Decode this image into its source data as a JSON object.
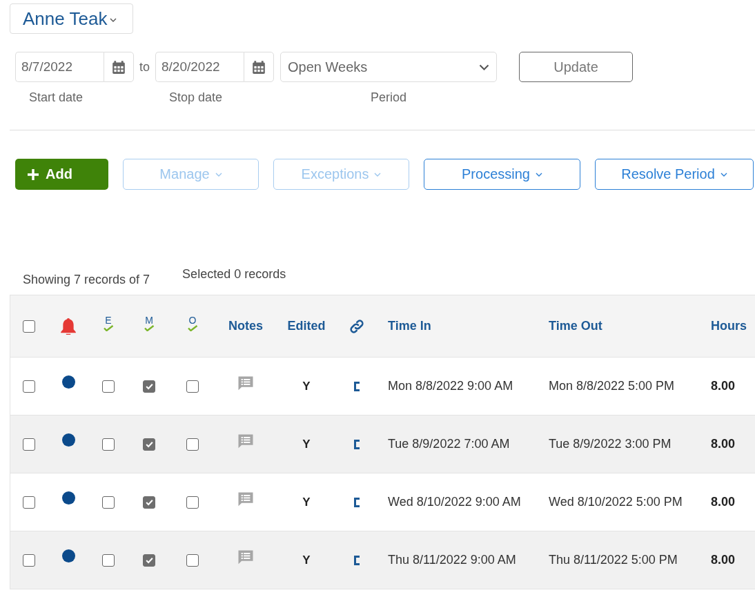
{
  "employee": {
    "name": "Anne Teak"
  },
  "filters": {
    "start_date": {
      "value": "8/7/2022",
      "label": "Start date"
    },
    "separator": "to",
    "stop_date": {
      "value": "8/20/2022",
      "label": "Stop date"
    },
    "period": {
      "value": "Open Weeks",
      "label": "Period"
    },
    "update_button": "Update"
  },
  "actions": [
    {
      "label": "Add",
      "kind": "primary",
      "disabled": false
    },
    {
      "label": "Manage",
      "kind": "menu",
      "disabled": true
    },
    {
      "label": "Exceptions",
      "kind": "menu",
      "disabled": true
    },
    {
      "label": "Processing",
      "kind": "menu",
      "disabled": false
    },
    {
      "label": "Resolve Period",
      "kind": "menu",
      "disabled": false
    }
  ],
  "summary": {
    "showing": "Showing 7 records of 7",
    "selected": "Selected 0 records"
  },
  "table": {
    "header": {
      "select_all_checked": false,
      "e": "E",
      "m": "M",
      "o": "O",
      "notes": "Notes",
      "edited": "Edited",
      "time_in": "Time In",
      "time_out": "Time Out",
      "hours": "Hours"
    },
    "rows": [
      {
        "selected": false,
        "color": "#0b4a8b",
        "e": false,
        "m": true,
        "o": false,
        "edited": "Y",
        "time_in": "Mon 8/8/2022 9:00 AM",
        "time_out": "Mon 8/8/2022 5:00 PM",
        "hours": "8.00"
      },
      {
        "selected": false,
        "color": "#0b4a8b",
        "e": false,
        "m": true,
        "o": false,
        "edited": "Y",
        "time_in": "Tue 8/9/2022 7:00 AM",
        "time_out": "Tue 8/9/2022 3:00 PM",
        "hours": "8.00"
      },
      {
        "selected": false,
        "color": "#0b4a8b",
        "e": false,
        "m": true,
        "o": false,
        "edited": "Y",
        "time_in": "Wed 8/10/2022 9:00 AM",
        "time_out": "Wed 8/10/2022 5:00 PM",
        "hours": "8.00"
      },
      {
        "selected": false,
        "color": "#0b4a8b",
        "e": false,
        "m": true,
        "o": false,
        "edited": "Y",
        "time_in": "Thu 8/11/2022 9:00 AM",
        "time_out": "Thu 8/11/2022 5:00 PM",
        "hours": "8.00"
      }
    ]
  }
}
